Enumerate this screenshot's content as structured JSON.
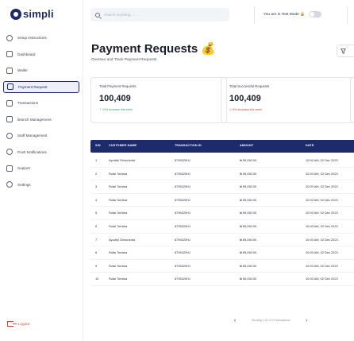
{
  "brand": "simpli",
  "search": {
    "placeholder": "Search anything......"
  },
  "header": {
    "test_mode_label": "You are in Test Mode 🔒"
  },
  "sidebar": {
    "items": [
      {
        "label": "Setup Instructions",
        "icon": "settings-circle-icon"
      },
      {
        "label": "Dashboard",
        "icon": "grid-icon"
      },
      {
        "label": "Wallet",
        "icon": "wallet-icon"
      },
      {
        "label": "Payment Request",
        "icon": "payment-request-icon",
        "active": true
      },
      {
        "label": "Transactions",
        "icon": "transactions-icon"
      },
      {
        "label": "Branch Management",
        "icon": "branch-icon"
      },
      {
        "label": "Staff Management",
        "icon": "staff-icon"
      },
      {
        "label": "Push Notifications",
        "icon": "bell-icon"
      },
      {
        "label": "Support",
        "icon": "support-icon"
      },
      {
        "label": "Settings",
        "icon": "gear-icon"
      }
    ],
    "logout": "Logout"
  },
  "page": {
    "title": "Payment Requests 💰",
    "subtitle": "Oversee and Track Payment Requests"
  },
  "stats": [
    {
      "label": "Total Payment Requests",
      "value": "100,409",
      "trend": "12% increase this week",
      "trend_dir": "up"
    },
    {
      "label": "Total Successful Requests",
      "value": "100,409",
      "trend": "8% decrease this week",
      "trend_dir": "down"
    }
  ],
  "table": {
    "columns": [
      "S/N",
      "CUSTOMER NAME",
      "TRANSACTION ID",
      "AMOUNT",
      "DATE"
    ],
    "rows": [
      {
        "sn": "1",
        "name": "Ayodeji Oloruntoba",
        "txn": "8795320HJ",
        "amount": "₦ 55,050.00",
        "date": "10:00 AM, 02 Dec 2023"
      },
      {
        "sn": "2",
        "name": "Rufai Tomiwa",
        "txn": "8795320HJ",
        "amount": "₦ 55,050.00",
        "date": "10:00 AM, 02 Dec 2023"
      },
      {
        "sn": "3",
        "name": "Rufai Tomiwa",
        "txn": "8795320HJ",
        "amount": "₦ 55,050.00",
        "date": "10:00 AM, 02 Dec 2023"
      },
      {
        "sn": "4",
        "name": "Rufai Tomiwa",
        "txn": "8795320HJ",
        "amount": "₦ 55,050.00",
        "date": "10:00 AM, 02 Dec 2023"
      },
      {
        "sn": "5",
        "name": "Rufai Tomiwa",
        "txn": "8795320HJ",
        "amount": "₦ 55,050.00",
        "date": "10:00 AM, 02 Dec 2023"
      },
      {
        "sn": "6",
        "name": "Rufai Tomiwa",
        "txn": "8795320HJ",
        "amount": "₦ 55,050.00",
        "date": "10:00 AM, 02 Dec 2023"
      },
      {
        "sn": "7",
        "name": "Ayodeji Oloruntoba",
        "txn": "8795320HJ",
        "amount": "₦ 55,050.00",
        "date": "10:00 AM, 02 Dec 2023"
      },
      {
        "sn": "8",
        "name": "Rufai Tomiwa",
        "txn": "8795320HJ",
        "amount": "₦ 55,050.00",
        "date": "10:00 AM, 02 Dec 2023"
      },
      {
        "sn": "9",
        "name": "Rufai Tomiwa",
        "txn": "8795320HJ",
        "amount": "₦ 55,050.00",
        "date": "10:00 AM, 02 Dec 2023"
      },
      {
        "sn": "10",
        "name": "Rufai Tomiwa",
        "txn": "8795320HJ",
        "amount": "₦ 55,050.00",
        "date": "10:00 AM, 02 Dec 2023"
      }
    ]
  },
  "pagination": {
    "text": "Showing 1-20 of 57 transactions",
    "prev": "‹",
    "next": "›"
  },
  "colors": {
    "primary": "#1d2a6b",
    "success": "#2f9e5f",
    "danger": "#d9433a"
  }
}
